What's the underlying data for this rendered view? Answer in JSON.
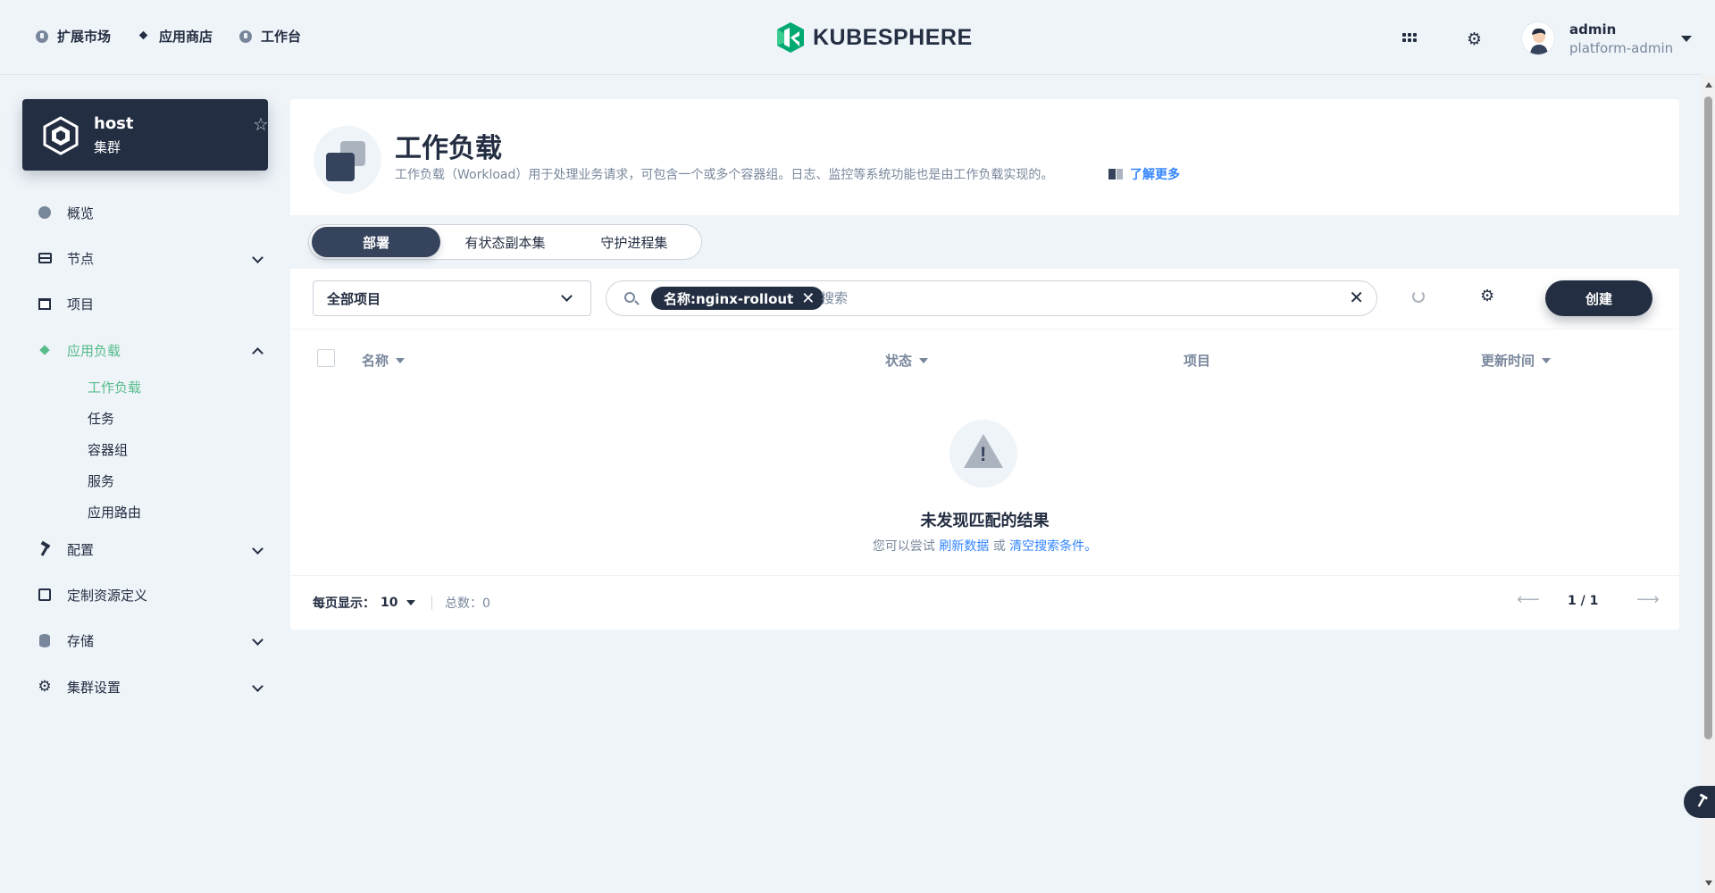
{
  "header": {
    "nav": [
      {
        "label": "扩展市场",
        "icon": "extension-icon"
      },
      {
        "label": "应用商店",
        "icon": "app-store-icon"
      },
      {
        "label": "工作台",
        "icon": "workbench-icon"
      }
    ],
    "logo_text": "KUBESPHERE",
    "user": {
      "name": "admin",
      "role": "platform-admin"
    }
  },
  "sidebar": {
    "cluster": {
      "name": "host",
      "subtitle": "集群"
    },
    "items": [
      {
        "label": "概览",
        "icon": "overview-icon",
        "expandable": false
      },
      {
        "label": "节点",
        "icon": "nodes-icon",
        "expandable": true
      },
      {
        "label": "项目",
        "icon": "projects-icon",
        "expandable": false
      },
      {
        "label": "应用负载",
        "icon": "app-workloads-icon",
        "expandable": true,
        "expanded": true,
        "active": true
      },
      {
        "label": "配置",
        "icon": "configuration-icon",
        "expandable": true
      },
      {
        "label": "定制资源定义",
        "icon": "crd-icon",
        "expandable": false
      },
      {
        "label": "存储",
        "icon": "storage-icon",
        "expandable": true
      },
      {
        "label": "集群设置",
        "icon": "cluster-settings-icon",
        "expandable": true
      }
    ],
    "sub_items": [
      {
        "label": "工作负载",
        "active": true
      },
      {
        "label": "任务"
      },
      {
        "label": "容器组"
      },
      {
        "label": "服务"
      },
      {
        "label": "应用路由"
      }
    ]
  },
  "page": {
    "title": "工作负载",
    "description": "工作负载（Workload）用于处理业务请求，可包含一个或多个容器组。日志、监控等系统功能也是由工作负载实现的。",
    "learn_more": "了解更多"
  },
  "tabs": [
    {
      "label": "部署",
      "active": true
    },
    {
      "label": "有状态副本集"
    },
    {
      "label": "守护进程集"
    }
  ],
  "toolbar": {
    "project_select": "全部项目",
    "filter_tag": "名称:nginx-rollout",
    "search_placeholder": "搜索",
    "create_label": "创建"
  },
  "table": {
    "columns": [
      {
        "label": "名称",
        "sortable": true
      },
      {
        "label": "状态",
        "sortable": true
      },
      {
        "label": "项目",
        "sortable": false
      },
      {
        "label": "更新时间",
        "sortable": true
      }
    ],
    "empty": {
      "title": "未发现匹配的结果",
      "hint_prefix": "您可以尝试",
      "refresh_link": "刷新数据",
      "or": "或",
      "clear_link": "清空搜索条件。"
    }
  },
  "pagination": {
    "per_page_label": "每页显示：",
    "per_page_value": "10",
    "total_label": "总数：",
    "total_value": "0",
    "page_display": "1 / 1"
  },
  "colors": {
    "accent": "#55bc8a",
    "dark": "#242e42",
    "link": "#3385ff",
    "muted": "#79879c",
    "background": "#eff4f9"
  }
}
